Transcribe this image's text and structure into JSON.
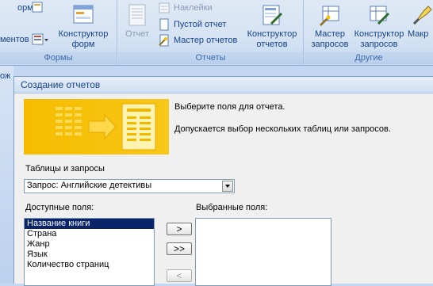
{
  "ribbon": {
    "forms_group": {
      "label": "Формы",
      "form_partial": "орма",
      "elements_partial": "ментов",
      "form_designer": "Конструктор\nформ"
    },
    "reports_group": {
      "label": "Отчеты",
      "report": "Отчет",
      "labels": "Наклейки",
      "blank_report": "Пустой отчет",
      "report_wizard": "Мастер отчетов",
      "report_designer": "Конструктор\nотчетов"
    },
    "other_group": {
      "label": "Другие",
      "query_wizard": "Мастер\nзапросов",
      "query_designer": "Конструктор\nзапросов",
      "macro_partial": "Макр"
    }
  },
  "leftstrip": {
    "partial_text": "ож"
  },
  "dialog": {
    "title": "Создание отчетов",
    "prompt": "Выберите поля для отчета.",
    "hint": "Допускается выбор нескольких таблиц или запросов.",
    "tables_label": "Таблицы и запросы",
    "tables_value": "Запрос: Английские детективы",
    "available_label": "Доступные поля:",
    "selected_label": "Выбранные поля:",
    "available_fields": [
      "Название книги",
      "Страна",
      "Жанр",
      "Язык",
      "Количество страниц"
    ],
    "selected_index": 0,
    "buttons": {
      "add": ">",
      "add_all": ">>",
      "remove": "<"
    }
  },
  "colors": {
    "ribbon_text": "#15428b",
    "selection": "#0a246a",
    "banner": "#f5c000"
  }
}
